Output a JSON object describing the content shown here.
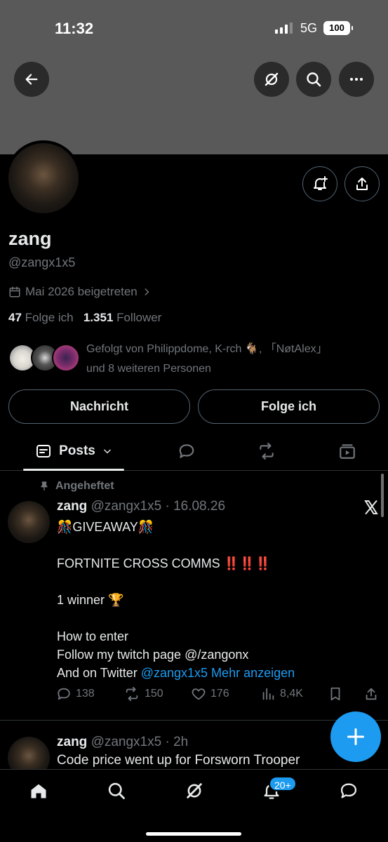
{
  "status_bar": {
    "time": "11:32",
    "network": "5G",
    "battery": "100"
  },
  "header": {
    "back_icon": "arrow-left-icon",
    "grok_icon": "grok-icon",
    "search_icon": "search-icon",
    "more_icon": "more-dots-icon"
  },
  "profile": {
    "name": "zang",
    "handle": "@zangx1x5",
    "joined": "Mai 2026 beigetreten",
    "following_count": "47",
    "following_label": "Folge ich",
    "followers_count": "1.351",
    "followers_label": "Follower",
    "followed_by_line1": "Gefolgt von Philippdome, K-rch 🐐, 「NøtAlex」",
    "followed_by_line2": "und 8 weiteren Personen"
  },
  "buttons": {
    "message": "Nachricht",
    "follow": "Folge ich"
  },
  "tabs": {
    "posts": "Posts"
  },
  "pinned_tweet": {
    "pinned_label": "Angeheftet",
    "name": "zang",
    "meta": "@zangx1x5 · 16.08.26",
    "lines": [
      "🎊GIVEAWAY🎊",
      "",
      "FORTNITE CROSS COMMS ‼️‼️‼️",
      "",
      "1 winner 🏆",
      "",
      "How to enter",
      "Follow my twitch page @/zangonx"
    ],
    "last_line_prefix": "And on Twitter ",
    "last_line_link": "@zangx1x5 Mehr anzeigen",
    "replies": "138",
    "reposts": "150",
    "likes": "176",
    "views": "8,4K"
  },
  "second_tweet": {
    "name": "zang",
    "meta": "@zangx1x5 · 2h",
    "text": "Code price went up for Forsworn Trooper"
  },
  "bottom_nav": {
    "notifications_badge": "20+"
  },
  "colors": {
    "accent": "#1d9bf0",
    "muted": "#71767b",
    "border": "#536471"
  }
}
